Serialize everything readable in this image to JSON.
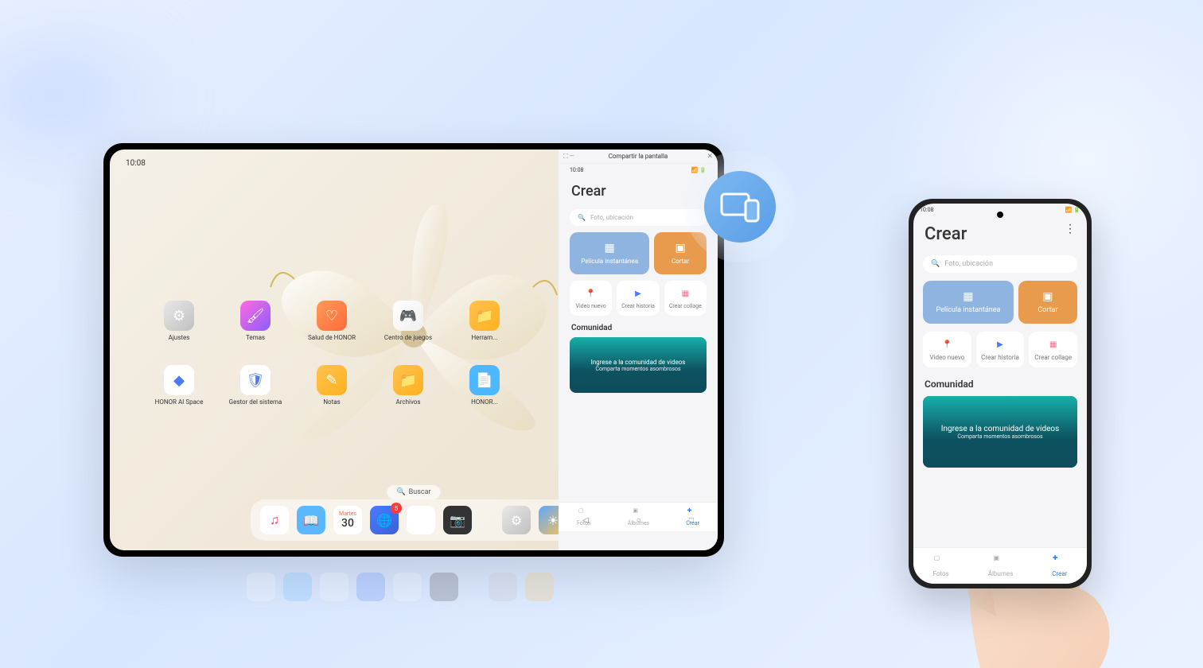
{
  "tablet": {
    "time": "10:08",
    "status_icons": "⚡ ⁴ᴳ 📶 🔋",
    "apps_row1": [
      {
        "label": "Ajustes",
        "icon": "⚙",
        "bg": "linear-gradient(135deg,#e8e8e8,#c0c0c0)"
      },
      {
        "label": "Temas",
        "icon": "🖌",
        "bg": "linear-gradient(135deg,#ff6bdd,#8b5cff)"
      },
      {
        "label": "Salud de HONOR",
        "icon": "♡",
        "bg": "linear-gradient(135deg,#ff9a56,#ff6b3d)"
      },
      {
        "label": "Centro de juegos",
        "icon": "🎮",
        "bg": "linear-gradient(135deg,#fff,#f0f0f0)"
      },
      {
        "label": "Herram...",
        "icon": "📁",
        "bg": "linear-gradient(135deg,#ffc24d,#ffb020)"
      }
    ],
    "apps_row2": [
      {
        "label": "HONOR AI Space",
        "icon": "◆",
        "bg": "#fff"
      },
      {
        "label": "Gestor del sistema",
        "icon": "🛡",
        "bg": "#fff"
      },
      {
        "label": "Notas",
        "icon": "✎",
        "bg": "linear-gradient(135deg,#ffc24d,#ffb020)"
      },
      {
        "label": "Archivos",
        "icon": "📁",
        "bg": "linear-gradient(135deg,#ffc24d,#ffb020)"
      },
      {
        "label": "HONOR...",
        "icon": "📄",
        "bg": "#4db8ff"
      }
    ],
    "search": "Buscar",
    "dock": [
      {
        "icon": "♫",
        "bg": "#fff",
        "color": "#ff3b5c"
      },
      {
        "icon": "📖",
        "bg": "#5bb8ff"
      },
      {
        "calendar": true,
        "weekday": "Martes",
        "day": "30"
      },
      {
        "icon": "🌐",
        "bg": "linear-gradient(135deg,#4a7bff,#3b5fd8)",
        "badge": "5"
      },
      {
        "icon": "✿",
        "bg": "#fff"
      },
      {
        "icon": "📷",
        "bg": "#333"
      },
      {
        "spacer": true
      },
      {
        "icon": "⚙",
        "bg": "linear-gradient(135deg,#e8e8e8,#c0c0c0)"
      },
      {
        "icon": "☀",
        "bg": "linear-gradient(135deg,#5ba8ff,#ffc24d)"
      }
    ]
  },
  "mirror": {
    "title": "Compartir la pantalla"
  },
  "crear": {
    "time": "10:08",
    "title": "Crear",
    "search_placeholder": "Foto, ubicación",
    "action_movie": "Película instantánea",
    "action_cut": "Cortar",
    "action_video": "Video nuevo",
    "action_story": "Crear historia",
    "action_collage": "Crear collage",
    "section": "Comunidad",
    "banner_title": "Ingrese a la comunidad de videos",
    "banner_sub": "Comparta momentos asombrosos",
    "tab_photos": "Fotos",
    "tab_albums": "Álbumes",
    "tab_create": "Crear"
  }
}
